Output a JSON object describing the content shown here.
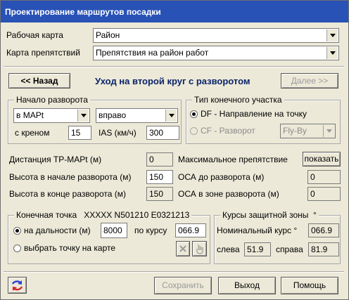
{
  "window": {
    "title": "Проектирование маршрутов посадки"
  },
  "maps": {
    "work_map_label": "Рабочая карта",
    "work_map_value": "Район",
    "obstacle_map_label": "Карта препятствий",
    "obstacle_map_value": "Препятствия на район работ"
  },
  "nav": {
    "back_label": "<< Назад",
    "step_title": "Уход на второй круг с разворотом",
    "next_label": "Далее >>"
  },
  "turn_start": {
    "title": "Начало разворота",
    "point_value": "в МАРt",
    "direction_value": "вправо",
    "bank_label": "с креном",
    "bank_value": "15",
    "ias_label": "IAS (км/ч)",
    "ias_value": "300"
  },
  "final_segment": {
    "title": "Тип конечного участка",
    "df_label": "DF - Направление на точку",
    "cf_label": "CF - Разворот",
    "flyby_value": "Fly-By"
  },
  "params": {
    "tp_mapt_label": "Дистанция ТР-МАРt (м)",
    "tp_mapt_value": "0",
    "max_obstacle_label": "Максимальное препятствие",
    "show_button_label": "показать",
    "height_start_label": "Высота в начале разворота (м)",
    "height_start_value": "150",
    "oca_before_label": "ОСА до разворота (м)",
    "oca_before_value": "0",
    "height_end_label": "Высота в конце разворота (м)",
    "height_end_value": "150",
    "oca_zone_label": "ОСА в зоне разворота (м)",
    "oca_zone_value": "0"
  },
  "end_point": {
    "title": "Конечная точка",
    "coords": "XXXXX N501210 E0321213",
    "distance_label": "на дальности (м)",
    "distance_value": "8000",
    "course_label": "по курсу",
    "course_value": "066.9",
    "pick_label": "выбрать точку на карте"
  },
  "protection": {
    "title": "Курсы защитной зоны",
    "degree_symbol": "°",
    "nominal_label": "Номинальный курс",
    "nominal_value": "066.9",
    "left_label": "слева",
    "left_value": "51.9",
    "right_label": "справа",
    "right_value": "81.9"
  },
  "footer": {
    "save_label": "Сохранить",
    "exit_label": "Выход",
    "help_label": "Помощь"
  }
}
